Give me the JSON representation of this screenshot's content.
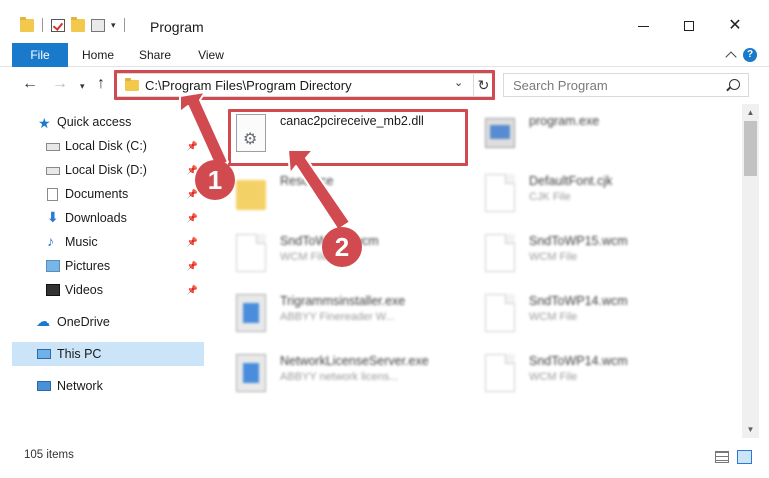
{
  "window": {
    "title": "Program",
    "qat_separator": "|",
    "qat_dropdown": "▾"
  },
  "ribbon": {
    "tabs": [
      {
        "label": "File"
      },
      {
        "label": "Home"
      },
      {
        "label": "Share"
      },
      {
        "label": "View"
      }
    ],
    "help": "?"
  },
  "nav": {
    "back": "←",
    "forward": "→",
    "recent": "▾",
    "up": "↑",
    "address": "C:\\Program Files\\Program Directory",
    "address_dropdown": "⌄",
    "refresh": "↻",
    "search_placeholder": "Search Program"
  },
  "sidebar": {
    "items": [
      {
        "label": "Quick access",
        "icon": "star-icon"
      },
      {
        "label": "Local Disk (C:)",
        "icon": "drive-icon",
        "pinned": true
      },
      {
        "label": "Local Disk (D:)",
        "icon": "drive-icon",
        "pinned": true
      },
      {
        "label": "Documents",
        "icon": "documents-icon",
        "pinned": true
      },
      {
        "label": "Downloads",
        "icon": "download-icon",
        "pinned": true
      },
      {
        "label": "Music",
        "icon": "music-icon",
        "pinned": true
      },
      {
        "label": "Pictures",
        "icon": "pictures-icon",
        "pinned": true
      },
      {
        "label": "Videos",
        "icon": "videos-icon",
        "pinned": true
      },
      {
        "label": "OneDrive",
        "icon": "cloud-icon"
      },
      {
        "label": "This PC",
        "icon": "computer-icon",
        "selected": true
      },
      {
        "label": "Network",
        "icon": "network-icon"
      }
    ]
  },
  "files": [
    {
      "name": "canac2pcireceive_mb2.dll",
      "type": "",
      "icon": "dll-file-icon"
    },
    {
      "name": "program.exe",
      "type": "",
      "icon": "exe-file-icon"
    },
    {
      "name": "Resource",
      "type": "",
      "icon": "folder-icon"
    },
    {
      "name": "DefaultFont.cjk",
      "type": "CJK File",
      "icon": "document-icon"
    },
    {
      "name": "SndToWP15.wcm",
      "type": "WCM File",
      "icon": "document-icon"
    },
    {
      "name": "SndToWP15.wcm",
      "type": "WCM File",
      "icon": "document-icon"
    },
    {
      "name": "Trigrammsinstaller.exe",
      "type": "ABBYY Finereader W...",
      "icon": "application-icon"
    },
    {
      "name": "SndToWP14.wcm",
      "type": "WCM File",
      "icon": "document-icon"
    },
    {
      "name": "NetworkLicenseServer.exe",
      "type": "ABBYY network licens...",
      "icon": "application-icon"
    },
    {
      "name": "SndToWP14.wcm",
      "type": "WCM File",
      "icon": "document-icon"
    }
  ],
  "status": {
    "item_count": "105 items"
  },
  "callouts": [
    "1",
    "2"
  ],
  "colors": {
    "accent": "#1979ca",
    "highlight": "#d04a4f",
    "selection": "#cce4f7"
  }
}
